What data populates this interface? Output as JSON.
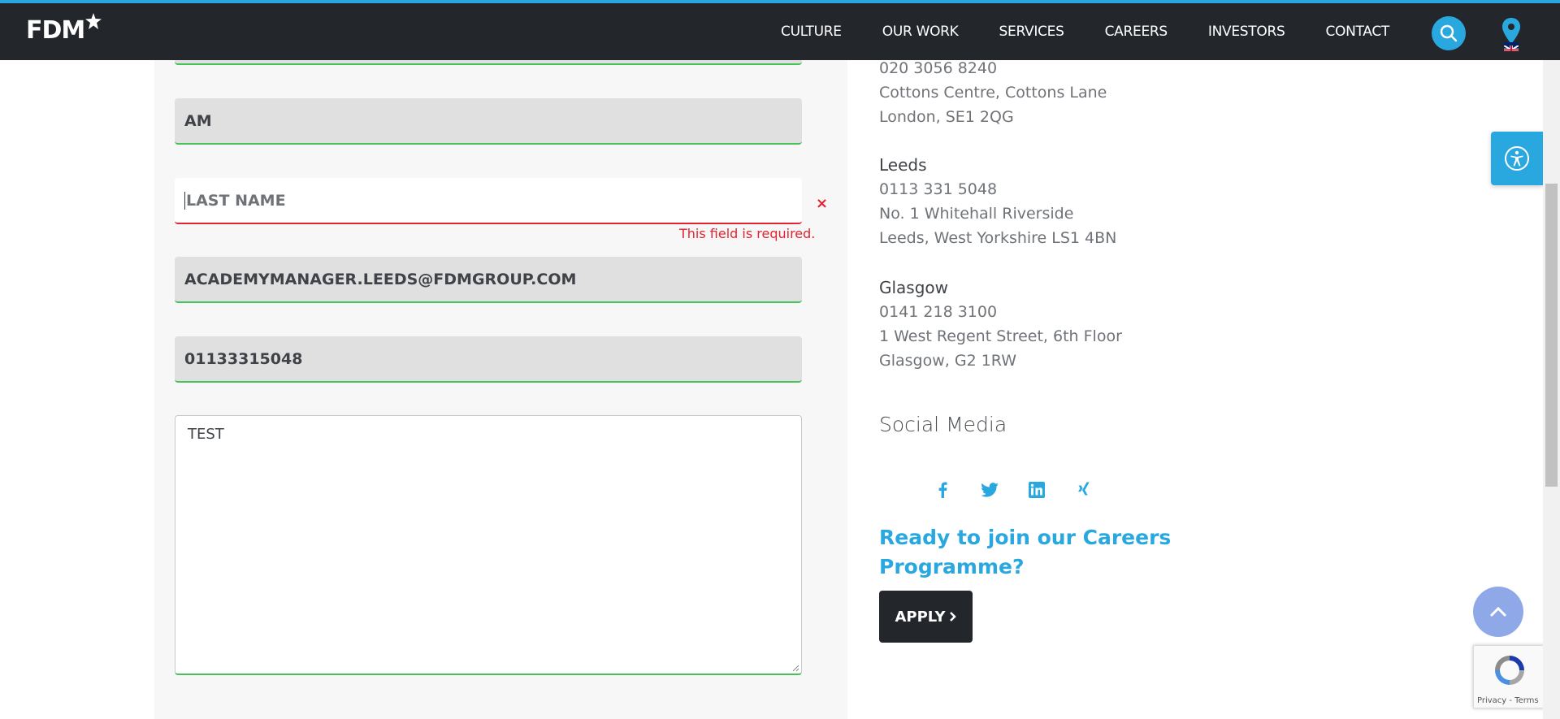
{
  "header": {
    "logo_text": "FDM",
    "nav": [
      "CULTURE",
      "OUR WORK",
      "SERVICES",
      "CAREERS",
      "INVESTORS",
      "CONTACT"
    ],
    "accent_color": "#29a8e0"
  },
  "form": {
    "first_name_value": "AM",
    "last_name_placeholder": "LAST NAME",
    "last_name_error": "This field is required.",
    "error_mark": "×",
    "email_value": "ACADEMYMANAGER.LEEDS@FDMGROUP.COM",
    "phone_value": "01133315048",
    "message_value": "TEST"
  },
  "offices": {
    "london": {
      "phone": "020 3056 8240",
      "address_line1": "Cottons Centre, Cottons Lane",
      "address_line2": "London, SE1 2QG"
    },
    "leeds": {
      "name": "Leeds",
      "phone": "0113 331 5048",
      "address_line1": "No. 1 Whitehall Riverside",
      "address_line2": "Leeds, West Yorkshire LS1 4BN"
    },
    "glasgow": {
      "name": "Glasgow",
      "phone": "0141 218 3100",
      "address_line1": "1 West Regent Street, 6th Floor",
      "address_line2": "Glasgow, G2 1RW"
    }
  },
  "social": {
    "title": "Social Media",
    "icons": [
      "facebook-icon",
      "twitter-icon",
      "linkedin-icon",
      "xing-icon"
    ]
  },
  "cta": {
    "heading": "Ready to join our Careers Programme?",
    "apply_label": "APPLY"
  },
  "recaptcha": {
    "links": "Privacy - Terms"
  }
}
